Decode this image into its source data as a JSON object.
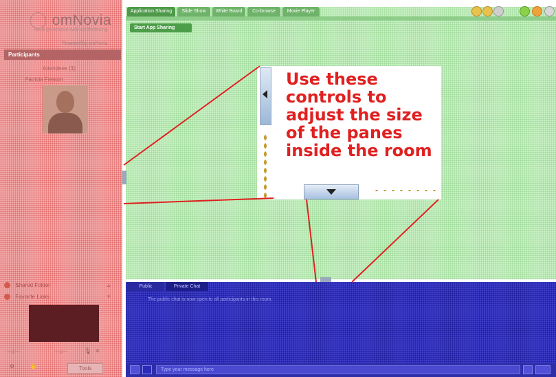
{
  "brand": {
    "logo_text": "omNovia",
    "tagline": "Next-generation web conferencing",
    "powered_by": "Powered by omNovia"
  },
  "sidebar": {
    "participants_title": "Participants",
    "participants": [
      {
        "label": "Attendees (1)"
      },
      {
        "label": "Patricia Fenson"
      }
    ],
    "panels": [
      {
        "label": "Shared Folder"
      },
      {
        "label": "Favorite Links"
      }
    ],
    "tools_label": "Tools"
  },
  "main": {
    "tabs": [
      {
        "label": "Application Sharing"
      },
      {
        "label": "Slide Show"
      },
      {
        "label": "White Board"
      },
      {
        "label": "Co-browse"
      },
      {
        "label": "Movie Player"
      }
    ],
    "start_button": "Start App Sharing"
  },
  "callout": {
    "lines": [
      "Use these",
      "controls to",
      "adjust the size",
      "of the panes",
      "inside the room"
    ]
  },
  "chat": {
    "tabs": [
      {
        "label": "Public"
      },
      {
        "label": "Private Chat"
      }
    ],
    "message": "The public chat is now open to all participants in this room.",
    "input_placeholder": "Type your message here"
  },
  "colors": {
    "sidebar_overlay": "#f2a8a8",
    "main_overlay": "#c8f0c4",
    "chat_overlay": "#3c3cc8",
    "callout_text": "#e02020",
    "pointer_lines": "#e02020"
  }
}
